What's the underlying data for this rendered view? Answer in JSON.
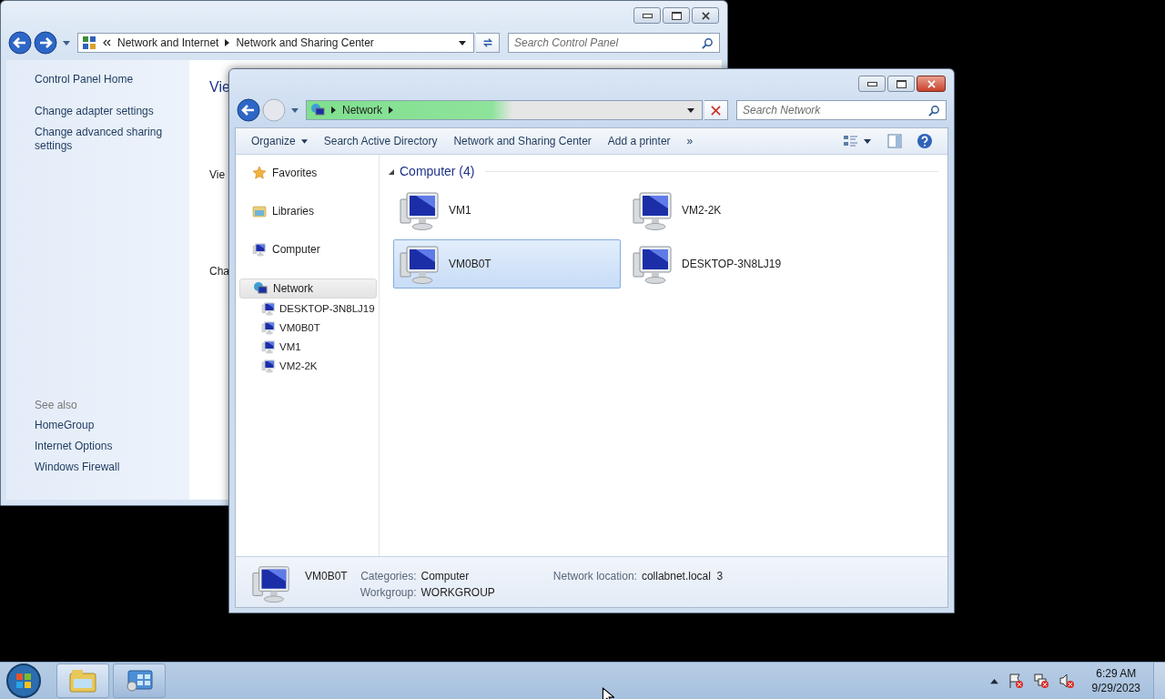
{
  "control_panel": {
    "breadcrumb": [
      "Network and Internet",
      "Network and Sharing Center"
    ],
    "search_placeholder": "Search Control Panel",
    "links": [
      "Control Panel Home",
      "Change adapter settings",
      "Change advanced sharing settings"
    ],
    "see_also_heading": "See also",
    "see_also": [
      "HomeGroup",
      "Internet Options",
      "Windows Firewall"
    ],
    "content_fragments": [
      "Vie",
      "Vie",
      "Cha"
    ]
  },
  "explorer": {
    "address": "Network",
    "level": 0.52,
    "search_placeholder": "Search Network",
    "toolbar": [
      {
        "label": "Organize",
        "dropdown": true
      },
      {
        "label": "Search Active Directory",
        "dropdown": false
      },
      {
        "label": "Network and Sharing Center",
        "dropdown": false
      },
      {
        "label": "Add a printer",
        "dropdown": false
      }
    ],
    "toolbar_overflow": "»",
    "nav": [
      {
        "kind": "favorites",
        "label": "Favorites",
        "selected": false
      },
      {
        "kind": "libraries",
        "label": "Libraries",
        "selected": false
      },
      {
        "kind": "computer",
        "label": "Computer",
        "selected": false
      },
      {
        "kind": "network",
        "label": "Network",
        "selected": true,
        "children": [
          {
            "label": "DESKTOP-3N8LJ19"
          },
          {
            "label": "VM0B0T"
          },
          {
            "label": "VM1"
          },
          {
            "label": "VM2-2K"
          }
        ]
      }
    ],
    "group": {
      "title": "Computer (4)",
      "expanded": true
    },
    "items": [
      {
        "label": "VM1",
        "selected": false
      },
      {
        "label": "VM2-2K",
        "selected": false
      },
      {
        "label": "VM0B0T",
        "selected": true
      },
      {
        "label": "DESKTOP-3N8LJ19",
        "selected": false
      }
    ],
    "details": {
      "name": "VM0B0T",
      "fields": [
        {
          "label": "Categories:",
          "value": "Computer"
        },
        {
          "label": "Workgroup:",
          "value": "WORKGROUP"
        }
      ],
      "location": {
        "label": "Network location:",
        "value": "collabnet.local  3"
      }
    }
  },
  "taskbar": {
    "time": "6:29 AM",
    "date": "9/29/2023"
  }
}
